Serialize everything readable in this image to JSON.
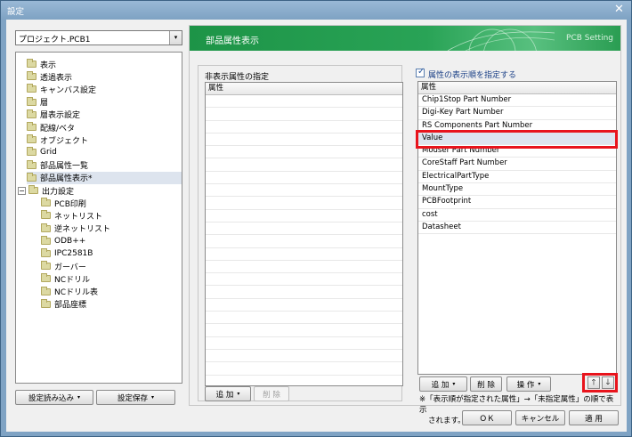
{
  "window": {
    "title": "設定",
    "close_glyph": "✕"
  },
  "project": {
    "selected": "プロジェクト.PCB1",
    "arrow": "▾"
  },
  "tree": {
    "items": [
      {
        "label": "表示"
      },
      {
        "label": "透過表示"
      },
      {
        "label": "キャンバス設定"
      },
      {
        "label": "層"
      },
      {
        "label": "層表示設定"
      },
      {
        "label": "配線/ベタ"
      },
      {
        "label": "オブジェクト"
      },
      {
        "label": "Grid"
      },
      {
        "label": "部品属性一覧"
      },
      {
        "label": "部品属性表示*"
      },
      {
        "label": "出力設定",
        "expander": "−"
      },
      {
        "label": "PCB印刷"
      },
      {
        "label": "ネットリスト"
      },
      {
        "label": "逆ネットリスト"
      },
      {
        "label": "ODB++"
      },
      {
        "label": "IPC2581B"
      },
      {
        "label": "ガーバー"
      },
      {
        "label": "NCドリル"
      },
      {
        "label": "NCドリル表"
      },
      {
        "label": "部品座標"
      }
    ]
  },
  "left_buttons": {
    "load": "設定読み込み",
    "save": "設定保存",
    "dd": "▾"
  },
  "header": {
    "title": "部品属性表示",
    "setting": "PCB Setting"
  },
  "hidden_panel": {
    "label": "非表示属性の指定",
    "column": "属性",
    "add": "追 加",
    "delete": "削 除",
    "dd": "▾"
  },
  "order_panel": {
    "checkbox_label": "属性の表示順を指定する",
    "checked": true,
    "column": "属性",
    "rows": [
      "Chip1Stop Part Number",
      "Digi-Key Part Number",
      "RS Components Part Number",
      "Value",
      "Mouser Part Number",
      "CoreStaff Part Number",
      "ElectricalPartType",
      "MountType",
      "PCBFootprint",
      "cost",
      "Datasheet"
    ],
    "selected_index": 3,
    "add": "追 加",
    "delete": "削 除",
    "operate": "操 作",
    "dd": "▾",
    "up": "🡑",
    "down": "🡓",
    "note_line1": "※「表示順が指定された属性」→「未指定属性」の順で表示",
    "note_line2": "されます。"
  },
  "footer": {
    "ok": "ＯＫ",
    "cancel": "キャンセル",
    "apply": "適 用"
  },
  "colors": {
    "header_green": "#1d9447",
    "highlight_red": "#e8141c",
    "selection": "#dde4ee"
  }
}
